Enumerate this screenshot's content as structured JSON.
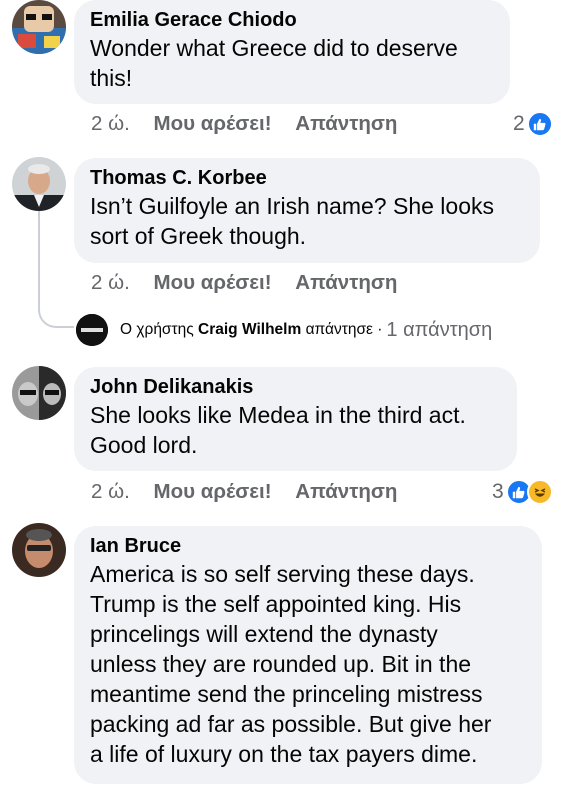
{
  "comments": [
    {
      "author": "Emilia Gerace Chiodo",
      "text_lines": [
        "Wonder what Greece did to deserve",
        "this!"
      ],
      "time": "2 ώ.",
      "like_label": "Μου αρέσει!",
      "reply_label": "Απάντηση",
      "reaction_count": "2",
      "reactions": [
        "like-icon"
      ]
    },
    {
      "author": "Thomas C. Korbee",
      "text_lines": [
        "Isn’t Guilfoyle an Irish name? She looks",
        "sort of Greek though."
      ],
      "time": "2 ώ.",
      "like_label": "Μου αρέσει!",
      "reply_label": "Απάντηση",
      "reply_summary": {
        "prefix": "Ο χρήστης",
        "name": "Craig Wilhelm",
        "verb": "απάντησε",
        "separator": "·",
        "count": "1 απάντηση"
      }
    },
    {
      "author": "John Delikanakis",
      "text_lines": [
        "She looks like Medea in the third act.",
        "Good lord."
      ],
      "time": "2 ώ.",
      "like_label": "Μου αρέσει!",
      "reply_label": "Απάντηση",
      "reaction_count": "3",
      "reactions": [
        "like-icon",
        "haha-icon"
      ]
    },
    {
      "author": "Ian Bruce",
      "text_lines": [
        "America is so self serving these days.",
        "Trump is the self appointed king. His",
        "princelings will extend the dynasty",
        "unless they are rounded up.  Bit in the",
        "meantime send the princeling mistress",
        "packing ad far as possible. But give her",
        "a life of luxury on the tax payers dime."
      ]
    }
  ],
  "colors": {
    "bubble": "#f0f2f5",
    "meta_text": "#65676b",
    "like_blue": "#1877f2",
    "haha_yellow": "#f7b928"
  }
}
